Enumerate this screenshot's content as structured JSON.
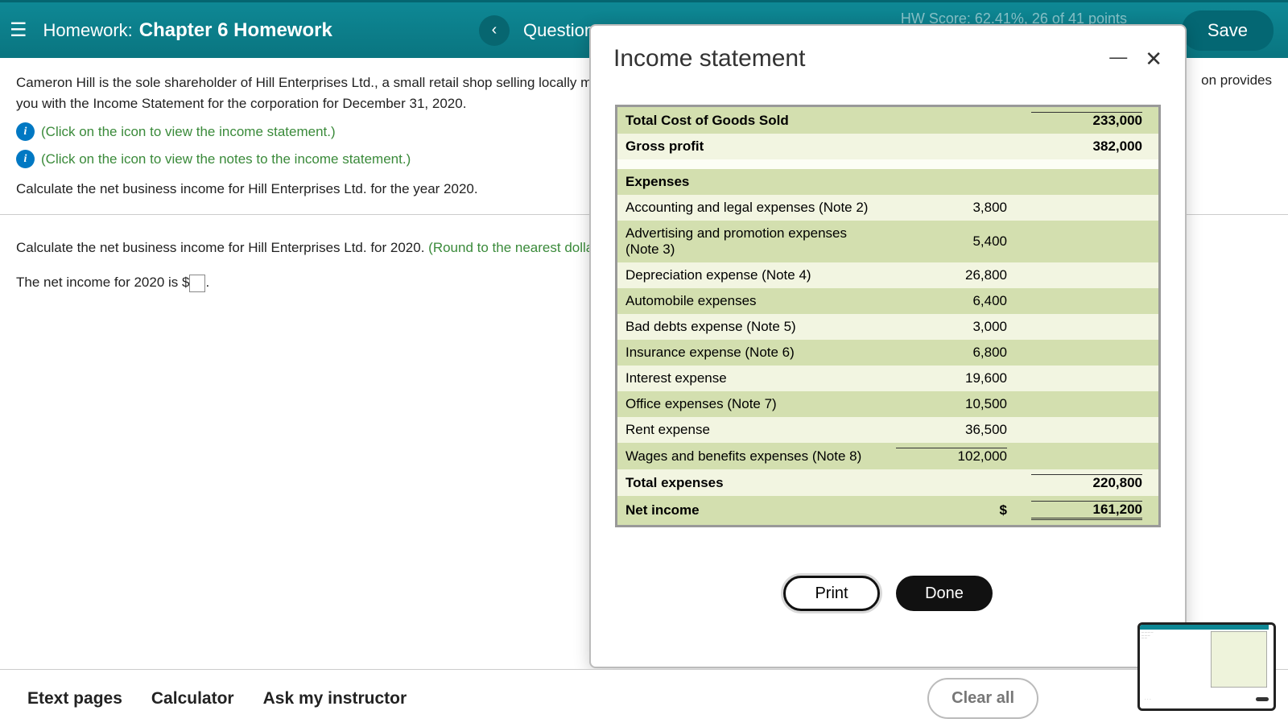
{
  "header": {
    "hw_label": "Homework:",
    "hw_title": "Chapter 6 Homework",
    "question_label": "Question",
    "prev_glyph": "‹",
    "hw_score": "HW Score: 62.41%, 26 of 41 points",
    "save": "Save"
  },
  "problem": {
    "p1": "Cameron Hill is the sole shareholder of Hill Enterprises Ltd., a small retail shop selling locally made",
    "p2": "you with the Income Statement for the corporation for December 31, 2020.",
    "right_edge": "on provides",
    "hint1": "(Click on the icon to view the income statement.)",
    "hint2": "(Click on the icon to view the notes to the income statement.)",
    "calc": "Calculate the net business income for Hill Enterprises Ltd. for the year 2020.",
    "calc2a": "Calculate the net business income for Hill Enterprises Ltd. for 2020. ",
    "calc2b": "(Round to the nearest dollar.)",
    "answer_pre": "The net income for 2020 is $",
    "answer_post": "."
  },
  "modal": {
    "title": "Income statement",
    "rows": [
      {
        "label": "Total Cost of Goods Sold",
        "v1": "",
        "v2": "233,000",
        "bold": true,
        "cls": "row-green",
        "line2": "total-line"
      },
      {
        "label": "Gross profit",
        "v1": "",
        "v2": "382,000",
        "bold": true,
        "cls": "row-light"
      },
      {
        "label": "",
        "v1": "",
        "v2": "",
        "cls": "row-plain"
      },
      {
        "label": "Expenses",
        "v1": "",
        "v2": "",
        "bold": true,
        "cls": "row-green"
      },
      {
        "label": "Accounting and legal expenses (Note 2)",
        "v1": "3,800",
        "v2": "",
        "cls": "row-light"
      },
      {
        "label": "Advertising and promotion expenses (Note 3)",
        "v1": "5,400",
        "v2": "",
        "cls": "row-green"
      },
      {
        "label": "Depreciation expense (Note 4)",
        "v1": "26,800",
        "v2": "",
        "cls": "row-light"
      },
      {
        "label": "Automobile expenses",
        "v1": "6,400",
        "v2": "",
        "cls": "row-green"
      },
      {
        "label": "Bad debts expense (Note 5)",
        "v1": "3,000",
        "v2": "",
        "cls": "row-light"
      },
      {
        "label": "Insurance expense (Note 6)",
        "v1": "6,800",
        "v2": "",
        "cls": "row-green"
      },
      {
        "label": "Interest expense",
        "v1": "19,600",
        "v2": "",
        "cls": "row-light"
      },
      {
        "label": "Office expenses (Note 7)",
        "v1": "10,500",
        "v2": "",
        "cls": "row-green"
      },
      {
        "label": "Rent expense",
        "v1": "36,500",
        "v2": "",
        "cls": "row-light"
      },
      {
        "label": "Wages and benefits expenses (Note 8)",
        "v1": "102,000",
        "v2": "",
        "cls": "row-green",
        "line1": "total-line"
      },
      {
        "label": "Total expenses",
        "v1": "",
        "v2": "220,800",
        "bold": true,
        "cls": "row-light",
        "line2": "total-line"
      },
      {
        "label": "Net income",
        "v1": "$",
        "v2": "161,200",
        "bold": true,
        "cls": "row-green",
        "line2": "double-line"
      }
    ],
    "print": "Print",
    "done": "Done"
  },
  "footer": {
    "etext": "Etext pages",
    "calc": "Calculator",
    "ask": "Ask my instructor",
    "clear": "Clear all"
  },
  "chart_data": {
    "type": "table",
    "title": "Income statement",
    "rows": [
      [
        "Total Cost of Goods Sold",
        233000
      ],
      [
        "Gross profit",
        382000
      ],
      [
        "Accounting and legal expenses (Note 2)",
        3800
      ],
      [
        "Advertising and promotion expenses (Note 3)",
        5400
      ],
      [
        "Depreciation expense (Note 4)",
        26800
      ],
      [
        "Automobile expenses",
        6400
      ],
      [
        "Bad debts expense (Note 5)",
        3000
      ],
      [
        "Insurance expense (Note 6)",
        6800
      ],
      [
        "Interest expense",
        19600
      ],
      [
        "Office expenses (Note 7)",
        10500
      ],
      [
        "Rent expense",
        36500
      ],
      [
        "Wages and benefits expenses (Note 8)",
        102000
      ],
      [
        "Total expenses",
        220800
      ],
      [
        "Net income",
        161200
      ]
    ]
  }
}
